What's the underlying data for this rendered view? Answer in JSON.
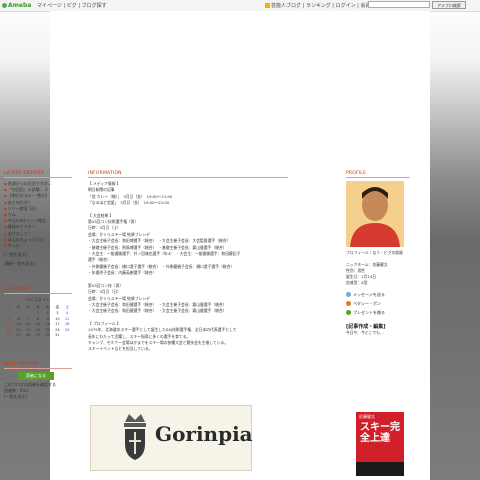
{
  "topbar": {
    "logo": "Ameba",
    "nav": "マイページ | ピグ | ブログ探す",
    "links": "芸能人ブログ | ランキング | ログイン | 会員登録",
    "search_placeholder": "",
    "search_button": "アメブロ検索"
  },
  "left": {
    "entries_title": "LATEST ENTRIES",
    "entries": [
      "急遽からの近況ですが…",
      "「何回目」の試験… 3",
      "【明日のスキー 雪も】",
      "あと何日か？",
      "リリー教室 1回",
      "ウム",
      "今日の4キャンプ報告",
      "雑誌のナイター",
      "あけまして！",
      "ほんのちょっとだけ",
      "やった"
    ],
    "entries_more": "[一覧を見る]",
    "themes_more": "[最新一覧を見る]",
    "calendar_title": "CALENDAR",
    "calendar_month": "<< 1月 >>",
    "calendar_days": [
      "日",
      "月",
      "火",
      "水",
      "木",
      "金",
      "土"
    ],
    "calendar_weeks": [
      [
        "",
        "",
        "",
        "1",
        "2",
        "3",
        "4"
      ],
      [
        "5",
        "6",
        "7",
        "8",
        "9",
        "10",
        "11"
      ],
      [
        "12",
        "13",
        "14",
        "15",
        "16",
        "17",
        "18"
      ],
      [
        "19",
        "20",
        "21",
        "22",
        "23",
        "24",
        "25"
      ],
      [
        "26",
        "27",
        "28",
        "29",
        "30",
        "31",
        ""
      ]
    ],
    "reader_title": "BLOG READER",
    "reader_button": "読者になる",
    "reader_desc": "このブログの読者を確認する",
    "reader_count": "読者数：64人",
    "reader_more": "[一覧を見る]"
  },
  "center": {
    "title": "INFORMATION",
    "lines": [
      "【 メディア情報 】",
      "朝日新聞の記事",
      "「恋 カレー（略）」　3月日（金）　19:00〜21:00",
      "「なるほど恋愛」　3月日（金）　19:00〜21:00",
      "",
      "【 大会結果 】",
      "第43回コン技術選手権（男）",
      "日時：3月日（土）",
      "会場：かぐらスキー場 結果プレシデ",
      "・大会主催子会長：和田博選手（総合）　・大会主催子会長：大会監督選手（総合）",
      "・基礎主催子会長：飛鳥博選手（総合）　・基礎主催子会長：霧山健選手（総合）",
      "・大会主：一般優勝選手：井ノ田雄也選手（年4）　・大会主：一般優勝選手：和田慶記子",
      "選手（総合）",
      "・外側優勝子会長：樋口澄子選手（総合）　・外側優勝子会長：樋口澄子選手（総合）",
      "・年優秀子会長：内藤英樹選手（総合）",
      "",
      "第43回コン技（男）",
      "日時：3月日（日）",
      "会場：かぐらスキー場 結果プレシデ",
      "・大会主催子会長：和田健選手（総合）　・大会主催子会長：霧山健選手（総合）",
      "・大会主催子会長：和田健選手（総合）　・大会主催子会長：霧山健選手（総合）",
      "",
      "【 プロフィール 】",
      "1975年、北海道のスキー選手として誕生したSAJ技術選手権、全日本の代表選手として",
      "長年にわたって活躍し、スキー指導に多くの選手を育てる。",
      "キャンプ、セミナー会場ほかまでをスキー場の各種大会と競技会を主催している。",
      "スキーイベントなどを担当している。"
    ],
    "banner_text": "Gorinpia"
  },
  "right": {
    "profile_title": "PROFILE",
    "profile_lines": [
      "プロフィール｜なう｜ピグの部屋",
      "",
      "ニックネーム：佐藤健太",
      "性別：男性",
      "誕生日：1月14日",
      "血液型：A型"
    ],
    "links": [
      {
        "label": "メッセージを送る",
        "icon": "envelope-icon",
        "color": "#7aa6d8"
      },
      {
        "label": "ペタシー・ポン",
        "icon": "bubble-icon",
        "color": "#e07a2e"
      },
      {
        "label": "プレゼントを贈る",
        "icon": "gift-icon",
        "color": "#5aa02c"
      }
    ],
    "book_heading": "[記事作成・編集]",
    "book_sub": "今日や、今どこでも…",
    "book_title_top": "佐藤健太",
    "book_title": "スキー完全上達"
  },
  "colors": {
    "accent": "#cc3300",
    "reader_button": "#5aa02c",
    "logo_green": "#3a9a2a",
    "book_red": "#d2202a"
  }
}
